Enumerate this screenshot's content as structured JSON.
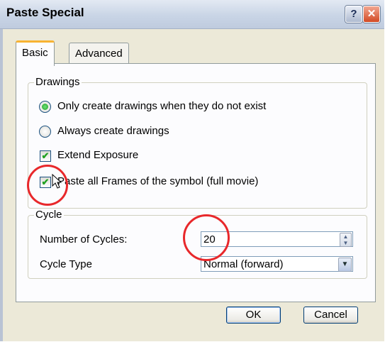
{
  "window": {
    "title": "Paste Special",
    "help_label": "?",
    "close_label": "✕"
  },
  "tabs": [
    {
      "label": "Basic"
    },
    {
      "label": "Advanced"
    }
  ],
  "drawings": {
    "legend": "Drawings",
    "only_create": {
      "label": "Only create drawings when they do not exist",
      "selected": true
    },
    "always_create": {
      "label": "Always create drawings",
      "selected": false
    },
    "extend_exposure": {
      "label": "Extend Exposure",
      "checked": true
    },
    "paste_all_frames": {
      "label": "Paste all Frames of the symbol (full movie)",
      "checked": true
    }
  },
  "cycle": {
    "legend": "Cycle",
    "number_label": "Number of Cycles:",
    "number_value": "20",
    "type_label": "Cycle Type",
    "type_value": "Normal (forward)"
  },
  "buttons": {
    "ok": "OK",
    "cancel": "Cancel"
  },
  "icons": {
    "check_mark": "✔",
    "spin_up": "▲",
    "spin_down": "▼",
    "dropdown": "▼"
  },
  "colors": {
    "annotation": "#e8282b",
    "check": "#21a121",
    "tab_highlight": "#f8b332"
  }
}
